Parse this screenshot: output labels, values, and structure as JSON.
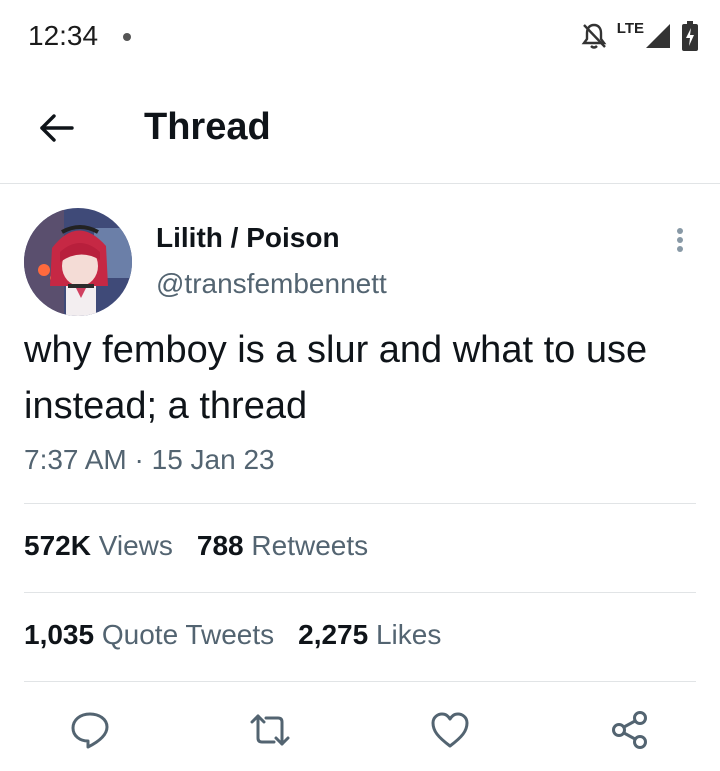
{
  "status_bar": {
    "time": "12:34",
    "network": "LTE",
    "icons": [
      "notifications-off-icon",
      "signal-icon",
      "battery-charging-icon"
    ]
  },
  "header": {
    "back_icon": "arrow-left-icon",
    "title": "Thread"
  },
  "tweet": {
    "author_name": "Lilith / Poison",
    "author_handle": "@transfembennett",
    "text": "why femboy is a slur and what to use instead; a thread",
    "time": "7:37 AM",
    "date": "15 Jan 23",
    "stats": {
      "views_count": "572K",
      "views_label": "Views",
      "retweets_count": "788",
      "retweets_label": "Retweets",
      "quotes_count": "1,035",
      "quotes_label": "Quote Tweets",
      "likes_count": "2,275",
      "likes_label": "Likes"
    }
  },
  "actions": [
    "reply-icon",
    "retweet-icon",
    "like-icon",
    "share-icon"
  ],
  "colors": {
    "text": "#0f1419",
    "secondary": "#536471",
    "icon": "#536471",
    "divider": "#e1e4e6"
  }
}
